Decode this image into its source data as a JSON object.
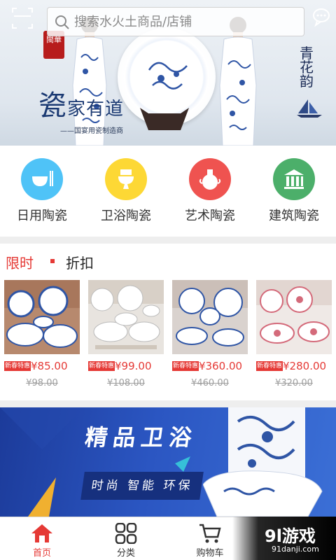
{
  "search": {
    "placeholder": "搜索水火土商品/店铺"
  },
  "hero": {
    "seal": "閩華",
    "tagline_big": "瓷",
    "tagline_rest": "家有道",
    "subtitle": "——国宴用瓷制造商",
    "calligraphy": "青花韵"
  },
  "categories": [
    {
      "label": "日用陶瓷",
      "icon": "bowl-icon",
      "color": "#4fc3f7"
    },
    {
      "label": "卫浴陶瓷",
      "icon": "toilet-icon",
      "color": "#fdd835"
    },
    {
      "label": "艺术陶瓷",
      "icon": "vase-icon",
      "color": "#ef5350"
    },
    {
      "label": "建筑陶瓷",
      "icon": "building-icon",
      "color": "#4caf6a"
    }
  ],
  "flash_sale": {
    "title_a": "限时",
    "title_b": "折扣",
    "accent": "#e53935",
    "products": [
      {
        "tag": "新春特惠",
        "price": "¥85.00",
        "old_price": "¥98.00"
      },
      {
        "tag": "新春特惠",
        "price": "¥99.00",
        "old_price": "¥108.00"
      },
      {
        "tag": "新春特惠",
        "price": "¥360.00",
        "old_price": "¥460.00"
      },
      {
        "tag": "新春特惠",
        "price": "¥280.00",
        "old_price": "¥320.00"
      }
    ]
  },
  "promo": {
    "title": "精品卫浴",
    "subtitle": "时尚 智能 环保"
  },
  "bottom_nav": [
    {
      "label": "首页",
      "icon": "home-icon",
      "active": true
    },
    {
      "label": "分类",
      "icon": "grid-icon",
      "active": false
    },
    {
      "label": "购物车",
      "icon": "cart-icon",
      "active": false
    }
  ],
  "watermark": {
    "logo": "9l游戏",
    "url": "91danji.com"
  }
}
